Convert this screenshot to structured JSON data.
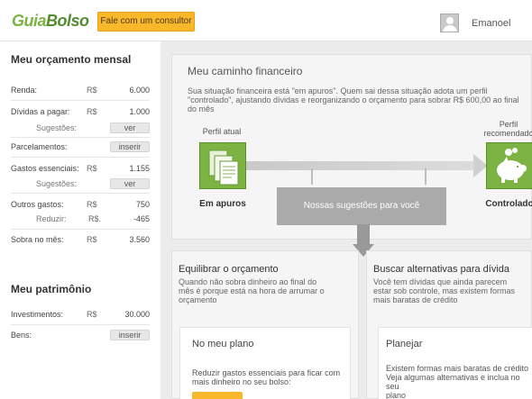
{
  "header": {
    "logo_part1": "Guia",
    "logo_part2": "Bolso",
    "consult_button": "Fale com um consultor",
    "user_name": "Emanoel"
  },
  "budget": {
    "title": "Meu orçamento mensal",
    "currency": "R$",
    "renda": {
      "label": "Renda:",
      "value": "6.000"
    },
    "dividas": {
      "label": "Dívidas a pagar:",
      "value": "1.000"
    },
    "dividas_sug": {
      "label": "Sugestões:",
      "button": "ver"
    },
    "parcelamentos": {
      "label": "Parcelamentos:",
      "button": "inserir"
    },
    "gastos": {
      "label": "Gastos essenciais:",
      "value": "1.155"
    },
    "gastos_sug": {
      "label": "Sugestões:",
      "button": "ver"
    },
    "outros": {
      "label": "Outros gastos:",
      "value": "750"
    },
    "reduzir": {
      "label": "Reduzir:",
      "currency": "R$.",
      "value": "-465"
    },
    "sobra": {
      "label": "Sobra no mês:",
      "value": "3.560"
    }
  },
  "patrimonio": {
    "title": "Meu patrimônio",
    "investimentos": {
      "label": "Investimentos:",
      "value": "30.000"
    },
    "bens": {
      "label": "Bens:",
      "button": "inserir"
    }
  },
  "path": {
    "title": "Meu caminho financeiro",
    "desc_line1": "Sua situação financeira está \"em apuros\". Quem sai dessa situação adota um perfil",
    "desc_line2": "\"controlado\", ajustando dívidas e reorganizando o orçamento para sobrar R$ 600,00 ao final",
    "desc_line3": "do mês",
    "current_label": "Perfil atual",
    "current_name": "Em apuros",
    "recommended_label_1": "Perfil",
    "recommended_label_2": "recomendado",
    "recommended_name": "Controlado",
    "suggestions_button": "Nossas sugestões para você"
  },
  "equilibrar": {
    "title": "Equilibrar o orçamento",
    "desc_line1": "Quando não sobra dinheiro ao final do",
    "desc_line2": "mês é porque está na hora de arrumar o",
    "desc_line3": "orçamento",
    "box_title": "No meu plano",
    "box_line1": "Reduzir gastos essenciais para ficar com",
    "box_line2": "mais dinheiro no seu bolso:"
  },
  "buscar": {
    "title": "Buscar alternativas para dívida",
    "desc_line1": "Você tem dívidas que ainda parecem",
    "desc_line2": "estar sob controle, mas existem formas",
    "desc_line3": "mais baratas de crédito",
    "box_title": "Planejar",
    "box_line1": "Existem formas mais baratas de crédito",
    "box_line2": "Veja algumas alternativas e inclua no seu",
    "box_line3": "plano"
  },
  "colors": {
    "accent_green": "#7cb342",
    "button_yellow": "#f9b82b"
  }
}
